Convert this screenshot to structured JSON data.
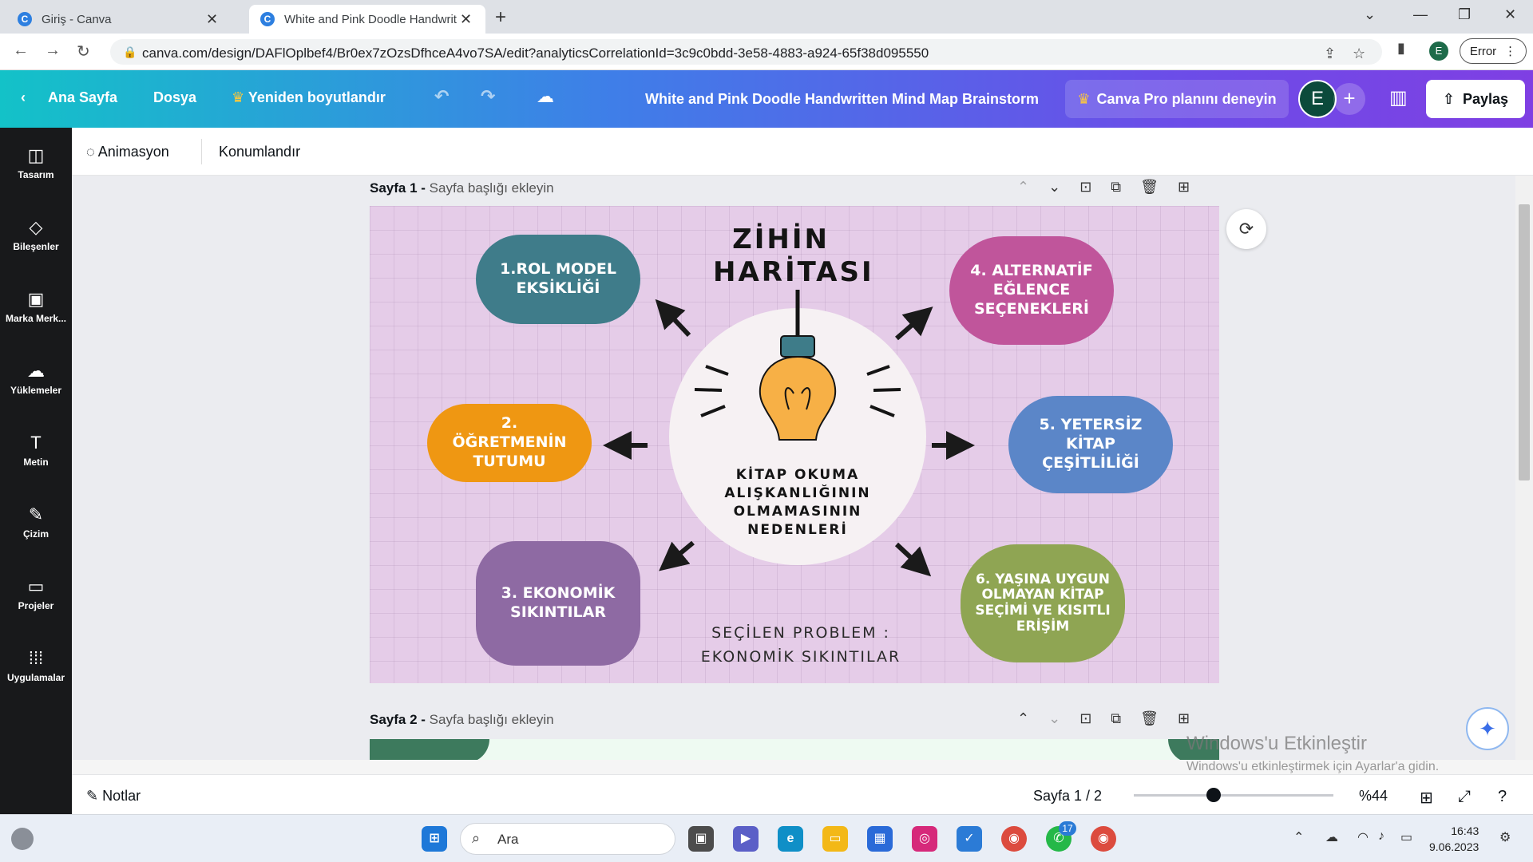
{
  "browser": {
    "tabs": [
      {
        "title": "Giriş - Canva"
      },
      {
        "title": "White and Pink Doodle Handwrit"
      }
    ],
    "url": "canva.com/design/DAFlOplbef4/Br0ex7zOzsDfhceA4vo7SA/edit?analyticsCorrelationId=3c9c0bdd-3e58-4883-a924-65f38d095550",
    "profile_initial": "E",
    "error_label": "Error"
  },
  "header": {
    "home": "Ana Sayfa",
    "file": "Dosya",
    "resize": "Yeniden boyutlandır",
    "doc_title": "White and Pink Doodle Handwritten Mind Map Brainstorm",
    "pro": "Canva Pro planını deneyin",
    "avatar": "E",
    "share": "Paylaş"
  },
  "sidebar": {
    "items": [
      {
        "label": "Tasarım",
        "icon": "layout-icon"
      },
      {
        "label": "Bileşenler",
        "icon": "shapes-icon"
      },
      {
        "label": "Marka Merk...",
        "icon": "brand-icon"
      },
      {
        "label": "Yüklemeler",
        "icon": "upload-icon"
      },
      {
        "label": "Metin",
        "icon": "text-icon"
      },
      {
        "label": "Çizim",
        "icon": "draw-icon"
      },
      {
        "label": "Projeler",
        "icon": "folder-icon"
      },
      {
        "label": "Uygulamalar",
        "icon": "apps-icon"
      }
    ]
  },
  "toolbar": {
    "animation": "Animasyon",
    "position": "Konumlandır"
  },
  "pages": [
    {
      "label": "Sayfa 1 -",
      "placeholder": "Sayfa başlığı ekleyin"
    },
    {
      "label": "Sayfa 2 -",
      "placeholder": "Sayfa başlığı ekleyin"
    }
  ],
  "design": {
    "title_line1": "ZİHİN",
    "title_line2": "HARİTASI",
    "center_text": "KİTAP OKUMA ALIŞKANLIĞININ OLMAMASININ NEDENLERİ",
    "items": [
      {
        "text": "1.ROL MODEL EKSİKLİĞİ",
        "color": "#3f7c8a"
      },
      {
        "text": "2. ÖĞRETMENİN TUTUMU",
        "color": "#ef9712"
      },
      {
        "text": "3. EKONOMİK SIKINTILAR",
        "color": "#8e6aa3"
      },
      {
        "text": "4. ALTERNATİF EĞLENCE SEÇENEKLERİ",
        "color": "#c0559b"
      },
      {
        "text": "5. YETERSİZ KİTAP ÇEŞİTLİLİĞİ",
        "color": "#5b86c8"
      },
      {
        "text": "6. YAŞINA UYGUN OLMAYAN KİTAP SEÇİMİ VE KISITLI ERİŞİM",
        "color": "#8fa553"
      }
    ],
    "selected_line1": "SEÇİLEN PROBLEM :",
    "selected_line2": "EKONOMİK SIKINTILAR"
  },
  "footer": {
    "notes": "Notlar",
    "page_indicator": "Sayfa 1 / 2",
    "zoom": "%44",
    "zoom_fraction": 0.44
  },
  "watermark": {
    "line1": "Windows'u Etkinleştir",
    "line2": "Windows'u etkinleştirmek için Ayarlar'a gidin."
  },
  "taskbar": {
    "search": "Ara",
    "teams_badge": "17",
    "time": "16:43",
    "date": "9.06.2023"
  }
}
